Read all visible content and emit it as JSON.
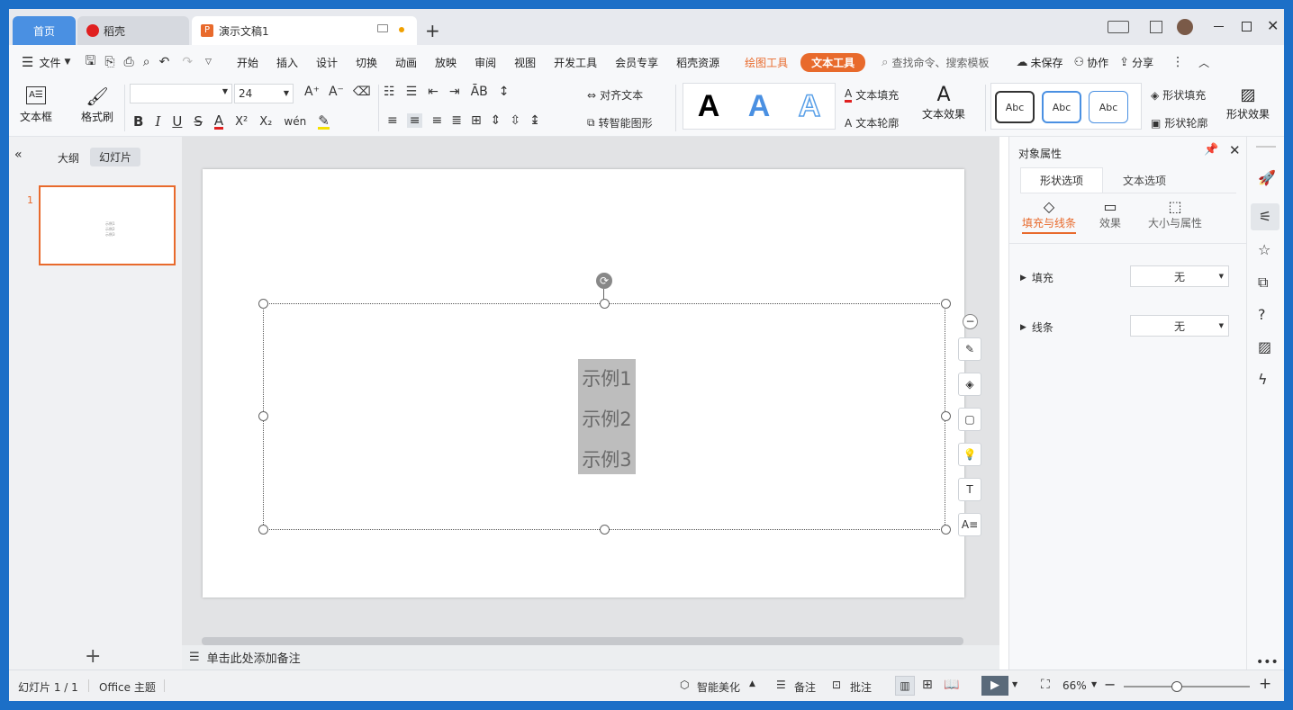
{
  "tabs": {
    "home": "首页",
    "daoke": "稻壳",
    "doc": "演示文稿1",
    "add": "+"
  },
  "menu": {
    "file": "文件",
    "items": [
      "开始",
      "插入",
      "设计",
      "切换",
      "动画",
      "放映",
      "审阅",
      "视图",
      "开发工具",
      "会员专享",
      "稻壳资源"
    ],
    "drawing_tools": "绘图工具",
    "text_tools": "文本工具",
    "search": "查找命令、搜索模板",
    "unsaved": "未保存",
    "collab": "协作",
    "share": "分享"
  },
  "ribbon": {
    "textbox": "文本框",
    "format_painter": "格式刷",
    "font_name": "",
    "font_size": "24",
    "align_text": "对齐文本",
    "smart_shape": "转智能图形",
    "text_fill": "文本填充",
    "text_outline": "文本轮廓",
    "text_effect": "文本效果",
    "style_sample": "Abc",
    "shape_fill": "形状填充",
    "shape_outline": "形状轮廓",
    "shape_effect": "形状效果",
    "art_letter": "A"
  },
  "leftpanel": {
    "outline": "大纲",
    "slides": "幻灯片",
    "slide_num": "1",
    "thumb_lines": [
      "示例1",
      "示例2",
      "示例3"
    ]
  },
  "slide": {
    "lines": [
      "示例1",
      "示例2",
      "示例3"
    ]
  },
  "notes": "单击此处添加备注",
  "props": {
    "title": "对象属性",
    "tab_shape": "形状选项",
    "tab_text": "文本选项",
    "sub_fill": "填充与线条",
    "sub_effect": "效果",
    "sub_size": "大小与属性",
    "fill_label": "填充",
    "fill_value": "无",
    "line_label": "线条",
    "line_value": "无"
  },
  "status": {
    "slide": "幻灯片 1 / 1",
    "theme": "Office 主题",
    "beautify": "智能美化",
    "notes": "备注",
    "comment": "批注",
    "zoom": "66%",
    "zoom_level": 0.42
  },
  "colors": {
    "accent": "#e86a2c",
    "tab_active": "#4a90e2",
    "selection": "#bdbdbd"
  }
}
